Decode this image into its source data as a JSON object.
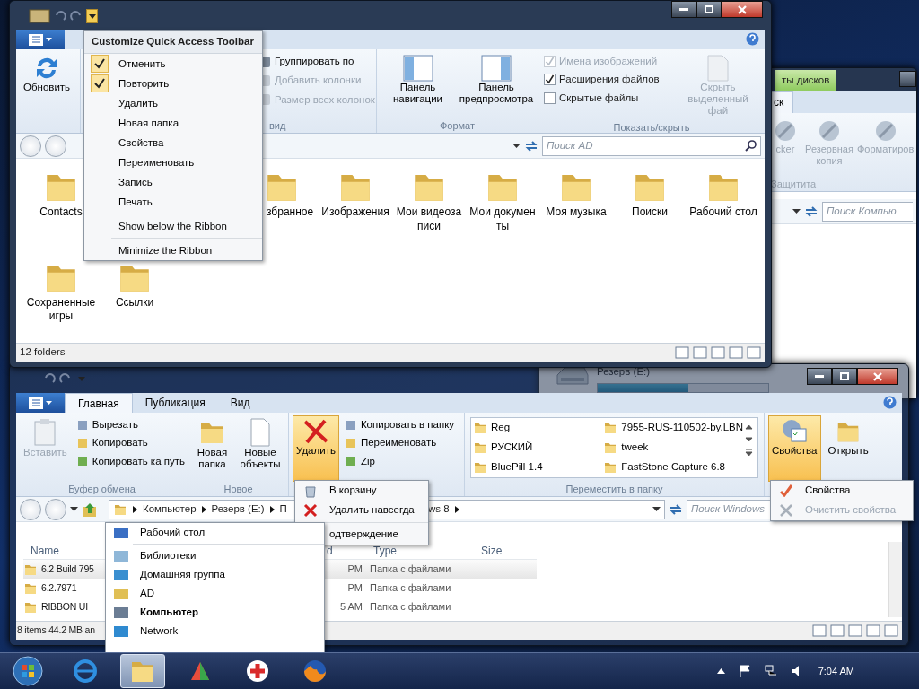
{
  "back_window": {
    "contextual_tab": "ты дисков",
    "tab": "ск",
    "commands": [
      "cker",
      "Резервная копия",
      "Форматиров"
    ],
    "group_label": "Защитита",
    "search_placeholder": "Поиск Компью",
    "drive": {
      "label": "Резерв (E:)",
      "level": 0.53
    }
  },
  "top_window": {
    "quick_access_menu": {
      "title": "Customize Quick Access Toolbar",
      "commands": [
        {
          "label": "Отменить",
          "checked": true
        },
        {
          "label": "Повторить",
          "checked": true
        },
        {
          "label": "Удалить",
          "checked": false
        },
        {
          "label": "Новая папка",
          "checked": false
        },
        {
          "label": "Свойства",
          "checked": false
        },
        {
          "label": "Переименовать",
          "checked": false
        },
        {
          "label": "Запись",
          "checked": false
        },
        {
          "label": "Печать",
          "checked": false
        }
      ],
      "options": [
        "Show below the Ribbon",
        "Minimize the Ribbon"
      ]
    },
    "refresh": "Обновить",
    "view_commands": [
      {
        "label": "Группировать по",
        "disabled": false
      },
      {
        "label": "Добавить колонки",
        "disabled": true
      },
      {
        "label": "Размер всех колонок",
        "disabled": true
      }
    ],
    "view_group": "вид",
    "panes": [
      "Панель навигации",
      "Панель предпросмотра"
    ],
    "format_group": "Формат",
    "show_hide": [
      {
        "label": "Имена изображений",
        "checked": true,
        "disabled": true
      },
      {
        "label": "Расширения файлов",
        "checked": true,
        "disabled": false
      },
      {
        "label": "Скрытые файлы",
        "checked": false,
        "disabled": false
      }
    ],
    "hide_selected": "Скрыть выделенный фай",
    "show_hide_group": "Показать/скрыть",
    "search_placeholder": "Поиск AD",
    "folders": [
      "Contacts",
      "збранное",
      "Изображения",
      "Мои видеозаписи",
      "Мои документы",
      "Моя музыка",
      "Поиски",
      "Рабочий стол",
      "Сохраненные игры",
      "Ссылки"
    ],
    "status": "12 folders"
  },
  "bottom_window": {
    "tabs": [
      {
        "label": "Главная",
        "selected": true
      },
      {
        "label": "Публикация",
        "selected": false
      },
      {
        "label": "Вид",
        "selected": false
      }
    ],
    "paste": {
      "label": "Вставить",
      "disabled": true
    },
    "clipboard_commands": [
      "Вырезать",
      "Копировать",
      "Копировать ка путь"
    ],
    "clipboard_group": "Буфер обмена",
    "new_commands": [
      "Новая папка",
      "Новые объекты"
    ],
    "new_group": "Новое",
    "delete": {
      "label": "Удалить",
      "expanded": true
    },
    "organize_commands": [
      "Копировать в папку",
      "Переименовать",
      "Zip"
    ],
    "move_to": [
      "Reg",
      "7955-RUS-110502-by.LBN",
      "РУСКИЙ",
      "tweek",
      "BluePill 1.4",
      "FastStone Capture 6.8"
    ],
    "move_to_group": "Переместить в папку",
    "properties": {
      "label": "Свойства",
      "expanded": true
    },
    "open": "Открыть",
    "breadcrumb": [
      "Компьютер",
      "Резерв (E:)",
      "П"
    ],
    "breadcrumb_tail": "ws 8",
    "search_placeholder": "Поиск Windows",
    "columns": [
      "Name",
      "d",
      "Type",
      "Size"
    ],
    "rows": [
      {
        "name": "6.2 Build 795",
        "column_2": "PM",
        "type": "Папка с файлами",
        "selected": true
      },
      {
        "name": "6.2.7971",
        "column_2": "PM",
        "type": "Папка с файлами",
        "selected": false
      },
      {
        "name": "RIBBON UI",
        "column_2": "5 AM",
        "type": "Папка с файлами",
        "selected": false
      }
    ],
    "status": "8 items 44.2 MB an",
    "delete_menu": [
      "В корзину",
      "Удалить навсегда",
      "одтверждение"
    ],
    "location_menu": {
      "top": "Рабочий стол",
      "items": [
        {
          "label": "Библиотеки",
          "selected": false
        },
        {
          "label": "Домашняя группа",
          "selected": false
        },
        {
          "label": "AD",
          "selected": false
        },
        {
          "label": "Компьютер",
          "selected": true
        },
        {
          "label": "Network",
          "selected": false
        }
      ]
    },
    "properties_menu": [
      {
        "label": "Свойства",
        "disabled": false
      },
      {
        "label": "Очистить свойства",
        "disabled": true
      }
    ]
  },
  "taskbar": {
    "apps": [
      {
        "selected": false
      },
      {
        "selected": true
      },
      {
        "selected": false
      },
      {
        "selected": false
      },
      {
        "selected": false
      }
    ],
    "clock": "7:04 AM"
  }
}
